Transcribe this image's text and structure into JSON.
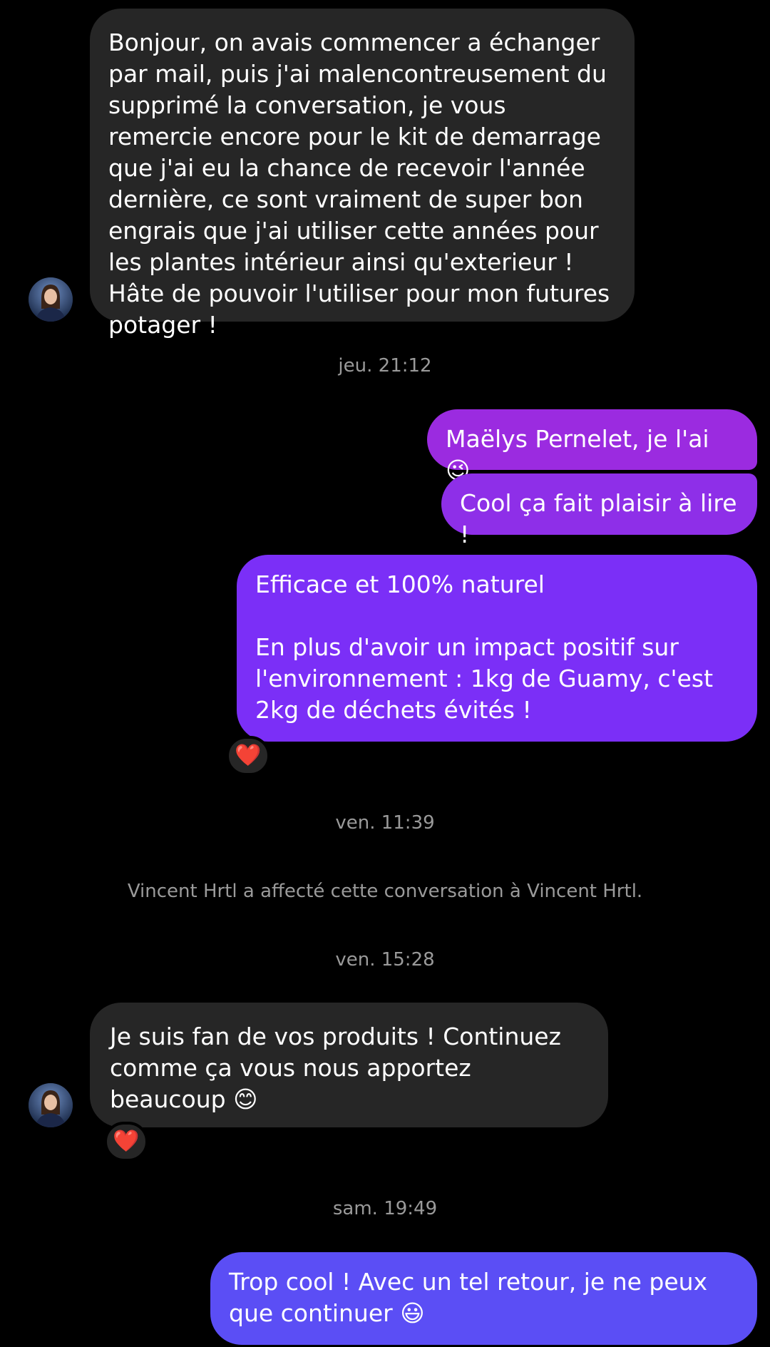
{
  "messages": {
    "m1": {
      "text": "Bonjour, on avais commencer a échanger par mail, puis j'ai malencontreusement du supprimé la conversation, je vous remercie encore pour le kit de demarrage que j'ai eu la chance de recevoir l'année dernière, ce sont vraiment de super bon engrais que j'ai utiliser cette années pour les plantes intérieur ainsi qu'exterieur ! Hâte de pouvoir l'utiliser pour mon futures potager !"
    },
    "m2": {
      "text": "Maëlys Pernelet, je l'ai 😉"
    },
    "m3": {
      "text": "Cool ça fait plaisir à lire !"
    },
    "m4": {
      "text": "Efficace et 100% naturel\n\nEn plus d'avoir un impact positif sur l'environnement : 1kg de Guamy, c'est 2kg de déchets évités !"
    },
    "m5": {
      "text": "Je suis fan de vos produits ! Continuez comme ça vous nous apportez beaucoup 😊"
    },
    "m6": {
      "text": "Trop cool ! Avec un tel retour, je ne peux que continuer 😃"
    }
  },
  "timestamps": {
    "t1": "jeu. 21:12",
    "t2": "ven. 11:39",
    "t3": "ven. 15:28",
    "t4": "sam. 19:49"
  },
  "system": {
    "assign_note": "Vincent Hrtl a affecté cette conversation à Vincent Hrtl."
  },
  "reactions": {
    "r1": "❤️",
    "r2": "❤️"
  },
  "colors": {
    "incoming_bubble": "#262626",
    "outgoing_purple": "#9b2be0",
    "outgoing_violet": "#7b2ff7",
    "outgoing_blue": "#5b4ef5",
    "background": "#000000"
  }
}
